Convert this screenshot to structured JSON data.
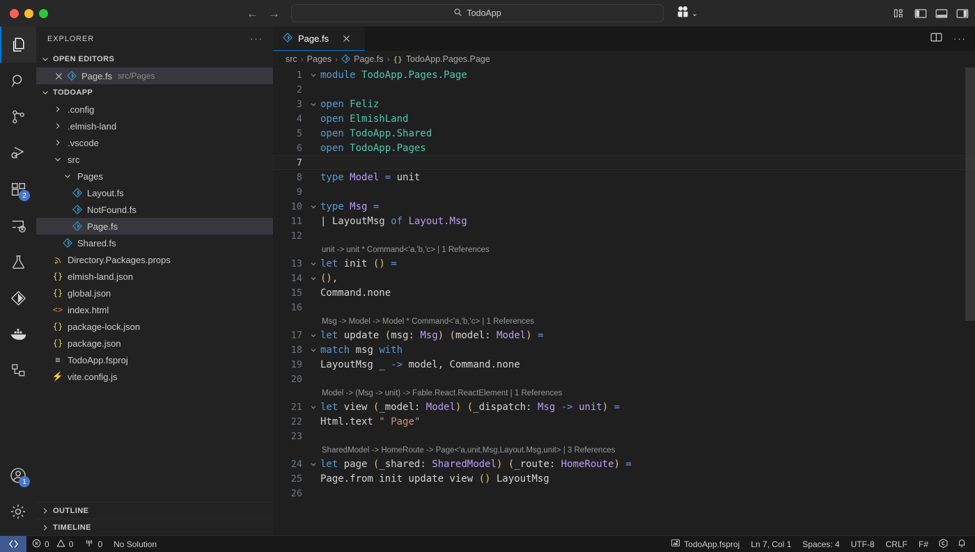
{
  "titlebar": {
    "back_label": "←",
    "forward_label": "→",
    "command_center_text": "TodoApp",
    "search_icon": "search-icon",
    "accounts_icon": "extensions-account-icon",
    "chevron": "⌄",
    "layout_buttons": [
      {
        "name": "customize-layout-button",
        "label": "Customize Layout"
      },
      {
        "name": "toggle-primary-sidebar-button",
        "label": "Toggle Primary Side Bar"
      },
      {
        "name": "toggle-panel-button",
        "label": "Toggle Panel"
      },
      {
        "name": "toggle-secondary-sidebar-button",
        "label": "Toggle Secondary Side Bar"
      }
    ]
  },
  "activitybar": {
    "items": [
      {
        "name": "explorer",
        "label": "Explorer",
        "active": true,
        "badge": ""
      },
      {
        "name": "search",
        "label": "Search",
        "active": false,
        "badge": ""
      },
      {
        "name": "source-control",
        "label": "Source Control",
        "active": false,
        "badge": ""
      },
      {
        "name": "run-and-debug",
        "label": "Run and Debug",
        "active": false,
        "badge": ""
      },
      {
        "name": "extensions",
        "label": "Extensions",
        "active": false,
        "badge": "2"
      },
      {
        "name": "remote-explorer",
        "label": "Remote Explorer",
        "active": false,
        "badge": ""
      },
      {
        "name": "testing",
        "label": "Testing",
        "active": false,
        "badge": ""
      },
      {
        "name": "fsharp",
        "label": "F#",
        "active": false,
        "badge": ""
      },
      {
        "name": "docker",
        "label": "Docker",
        "active": false,
        "badge": ""
      },
      {
        "name": "dev-containers",
        "label": "Dev Containers",
        "active": false,
        "badge": ""
      }
    ],
    "bottom": [
      {
        "name": "accounts",
        "label": "Accounts",
        "badge": "1"
      },
      {
        "name": "manage-settings",
        "label": "Manage",
        "badge": ""
      }
    ]
  },
  "sidebar": {
    "title": "EXPLORER",
    "more_actions": "···",
    "open_editors": {
      "label": "OPEN EDITORS",
      "items": [
        {
          "name": "Page.fs",
          "description": "src/Pages",
          "icon": "fsharp-icon",
          "selected": true
        }
      ]
    },
    "workspace": {
      "label": "TODOAPP",
      "items": [
        {
          "name": ".config",
          "type": "folder",
          "expanded": false,
          "indent": 1,
          "icon": "chevron-right-icon"
        },
        {
          "name": ".elmish-land",
          "type": "folder",
          "expanded": false,
          "indent": 1,
          "icon": "chevron-right-icon"
        },
        {
          "name": ".vscode",
          "type": "folder",
          "expanded": false,
          "indent": 1,
          "icon": "chevron-right-icon"
        },
        {
          "name": "src",
          "type": "folder",
          "expanded": true,
          "indent": 1,
          "icon": "chevron-down-icon"
        },
        {
          "name": "Pages",
          "type": "folder",
          "expanded": true,
          "indent": 2,
          "icon": "chevron-down-icon"
        },
        {
          "name": "Layout.fs",
          "type": "file",
          "indent": 3,
          "icon": "fsharp-icon"
        },
        {
          "name": "NotFound.fs",
          "type": "file",
          "indent": 3,
          "icon": "fsharp-icon"
        },
        {
          "name": "Page.fs",
          "type": "file",
          "indent": 3,
          "icon": "fsharp-icon",
          "selected": true
        },
        {
          "name": "Shared.fs",
          "type": "file",
          "indent": 2,
          "icon": "fsharp-icon"
        },
        {
          "name": "Directory.Packages.props",
          "type": "file",
          "indent": 1,
          "icon": "props-icon"
        },
        {
          "name": "elmish-land.json",
          "type": "file",
          "indent": 1,
          "icon": "json-icon"
        },
        {
          "name": "global.json",
          "type": "file",
          "indent": 1,
          "icon": "json-icon"
        },
        {
          "name": "index.html",
          "type": "file",
          "indent": 1,
          "icon": "html-icon"
        },
        {
          "name": "package-lock.json",
          "type": "file",
          "indent": 1,
          "icon": "json-icon"
        },
        {
          "name": "package.json",
          "type": "file",
          "indent": 1,
          "icon": "json-icon"
        },
        {
          "name": "TodoApp.fsproj",
          "type": "file",
          "indent": 1,
          "icon": "fsproj-icon"
        },
        {
          "name": "vite.config.js",
          "type": "file",
          "indent": 1,
          "icon": "vite-icon"
        }
      ]
    },
    "outline_label": "OUTLINE",
    "timeline_label": "TIMELINE"
  },
  "editor": {
    "tab": {
      "label": "Page.fs",
      "icon": "fsharp-icon",
      "close": "✕"
    },
    "actions": [
      {
        "name": "split-editor-right-button",
        "label": "Split Editor Right"
      },
      {
        "name": "more-editor-actions-button",
        "label": "More Actions..."
      }
    ],
    "breadcrumb": [
      "src",
      "Pages",
      "Page.fs",
      "TodoApp.Pages.Page"
    ],
    "breadcrumb_icons": [
      "",
      "",
      "fsharp-icon",
      "module-icon"
    ],
    "lines": [
      {
        "n": 1,
        "fold": "down",
        "cur": false,
        "tokens": [
          {
            "t": "module",
            "c": "kw"
          },
          {
            "t": " ",
            "c": "pun"
          },
          {
            "t": "TodoApp.Pages.Page",
            "c": "ns"
          }
        ]
      },
      {
        "n": 2,
        "fold": "",
        "cur": false,
        "tokens": []
      },
      {
        "n": 3,
        "fold": "down",
        "cur": false,
        "tokens": [
          {
            "t": "open",
            "c": "kw"
          },
          {
            "t": " ",
            "c": "pun"
          },
          {
            "t": "Feliz",
            "c": "ns"
          }
        ]
      },
      {
        "n": 4,
        "fold": "",
        "cur": false,
        "tokens": [
          {
            "t": "open",
            "c": "kw"
          },
          {
            "t": " ",
            "c": "pun"
          },
          {
            "t": "ElmishLand",
            "c": "ns"
          }
        ]
      },
      {
        "n": 5,
        "fold": "",
        "cur": false,
        "tokens": [
          {
            "t": "open",
            "c": "kw"
          },
          {
            "t": " ",
            "c": "pun"
          },
          {
            "t": "TodoApp.Shared",
            "c": "ns"
          }
        ]
      },
      {
        "n": 6,
        "fold": "",
        "cur": false,
        "tokens": [
          {
            "t": "open",
            "c": "kw"
          },
          {
            "t": " ",
            "c": "pun"
          },
          {
            "t": "TodoApp.Pages",
            "c": "ns"
          }
        ]
      },
      {
        "n": 7,
        "fold": "",
        "cur": true,
        "tokens": []
      },
      {
        "n": 8,
        "fold": "",
        "cur": false,
        "tokens": [
          {
            "t": "type",
            "c": "kw"
          },
          {
            "t": " ",
            "c": "pun"
          },
          {
            "t": "Model",
            "c": "typ"
          },
          {
            "t": " ",
            "c": "pun"
          },
          {
            "t": "=",
            "c": "op"
          },
          {
            "t": " ",
            "c": "pun"
          },
          {
            "t": "unit",
            "c": "id"
          }
        ]
      },
      {
        "n": 9,
        "fold": "",
        "cur": false,
        "tokens": []
      },
      {
        "n": 10,
        "fold": "down",
        "cur": false,
        "tokens": [
          {
            "t": "type",
            "c": "kw"
          },
          {
            "t": " ",
            "c": "pun"
          },
          {
            "t": "Msg",
            "c": "typ"
          },
          {
            "t": " ",
            "c": "pun"
          },
          {
            "t": "=",
            "c": "op"
          }
        ]
      },
      {
        "n": 11,
        "fold": "",
        "cur": false,
        "indentguide": 1,
        "tokens": [
          {
            "t": "    | ",
            "c": "pun"
          },
          {
            "t": "LayoutMsg",
            "c": "id"
          },
          {
            "t": " ",
            "c": "pun"
          },
          {
            "t": "of",
            "c": "kw"
          },
          {
            "t": " ",
            "c": "pun"
          },
          {
            "t": "Layout.Msg",
            "c": "typ"
          }
        ]
      },
      {
        "n": 12,
        "fold": "",
        "cur": false,
        "tokens": []
      },
      {
        "n": 13,
        "fold": "down",
        "cur": false,
        "lens": "unit -> unit * Command<'a,'b,'c> | 1 References",
        "tokens": [
          {
            "t": "let",
            "c": "kw"
          },
          {
            "t": " ",
            "c": "pun"
          },
          {
            "t": "init",
            "c": "id"
          },
          {
            "t": " ",
            "c": "pun"
          },
          {
            "t": "()",
            "c": "yel"
          },
          {
            "t": " ",
            "c": "pun"
          },
          {
            "t": "=",
            "c": "op"
          }
        ]
      },
      {
        "n": 14,
        "fold": "down",
        "cur": false,
        "indentguide": 1,
        "tokens": [
          {
            "t": "    ",
            "c": "pun"
          },
          {
            "t": "()",
            "c": "yel"
          },
          {
            "t": ",",
            "c": "yel"
          }
        ]
      },
      {
        "n": 15,
        "fold": "",
        "cur": false,
        "indentguide": 1,
        "tokens": [
          {
            "t": "    Command.none",
            "c": "id"
          }
        ]
      },
      {
        "n": 16,
        "fold": "",
        "cur": false,
        "tokens": []
      },
      {
        "n": 17,
        "fold": "down",
        "cur": false,
        "lens": "Msg -> Model -> Model * Command<'a,'b,'c> | 1 References",
        "tokens": [
          {
            "t": "let",
            "c": "kw"
          },
          {
            "t": " ",
            "c": "pun"
          },
          {
            "t": "update",
            "c": "id"
          },
          {
            "t": " ",
            "c": "pun"
          },
          {
            "t": "(",
            "c": "yel"
          },
          {
            "t": "msg",
            "c": "id"
          },
          {
            "t": ": ",
            "c": "pun"
          },
          {
            "t": "Msg",
            "c": "typ"
          },
          {
            "t": ")",
            "c": "yel"
          },
          {
            "t": " ",
            "c": "pun"
          },
          {
            "t": "(",
            "c": "yel"
          },
          {
            "t": "model",
            "c": "id"
          },
          {
            "t": ": ",
            "c": "pun"
          },
          {
            "t": "Model",
            "c": "typ"
          },
          {
            "t": ")",
            "c": "yel"
          },
          {
            "t": " ",
            "c": "pun"
          },
          {
            "t": "=",
            "c": "op"
          }
        ]
      },
      {
        "n": 18,
        "fold": "down",
        "cur": false,
        "indentguide": 1,
        "tokens": [
          {
            "t": "    ",
            "c": "pun"
          },
          {
            "t": "match",
            "c": "kw"
          },
          {
            "t": " ",
            "c": "pun"
          },
          {
            "t": "msg",
            "c": "id"
          },
          {
            "t": " ",
            "c": "pun"
          },
          {
            "t": "with",
            "c": "kw"
          }
        ]
      },
      {
        "n": 19,
        "fold": "",
        "cur": false,
        "indentguide": 2,
        "tokens": [
          {
            "t": "    | ",
            "c": "pun"
          },
          {
            "t": "LayoutMsg",
            "c": "id"
          },
          {
            "t": " ",
            "c": "pun"
          },
          {
            "t": "_",
            "c": "id"
          },
          {
            "t": " ",
            "c": "pun"
          },
          {
            "t": "->",
            "c": "op"
          },
          {
            "t": " ",
            "c": "pun"
          },
          {
            "t": "model",
            "c": "id"
          },
          {
            "t": ", ",
            "c": "pun"
          },
          {
            "t": "Command.none",
            "c": "id"
          }
        ]
      },
      {
        "n": 20,
        "fold": "",
        "cur": false,
        "tokens": []
      },
      {
        "n": 21,
        "fold": "down",
        "cur": false,
        "lens": "Model -> (Msg -> unit) -> Fable.React.ReactElement | 1 References",
        "tokens": [
          {
            "t": "let",
            "c": "kw"
          },
          {
            "t": " ",
            "c": "pun"
          },
          {
            "t": "view",
            "c": "id"
          },
          {
            "t": " ",
            "c": "pun"
          },
          {
            "t": "(",
            "c": "yel"
          },
          {
            "t": "_model",
            "c": "id"
          },
          {
            "t": ": ",
            "c": "pun"
          },
          {
            "t": "Model",
            "c": "typ"
          },
          {
            "t": ")",
            "c": "yel"
          },
          {
            "t": " ",
            "c": "pun"
          },
          {
            "t": "(",
            "c": "yel"
          },
          {
            "t": "_dispatch",
            "c": "id"
          },
          {
            "t": ": ",
            "c": "pun"
          },
          {
            "t": "Msg",
            "c": "typ"
          },
          {
            "t": " ",
            "c": "pun"
          },
          {
            "t": "->",
            "c": "op"
          },
          {
            "t": " ",
            "c": "pun"
          },
          {
            "t": "unit",
            "c": "typ"
          },
          {
            "t": ")",
            "c": "yel"
          },
          {
            "t": " ",
            "c": "pun"
          },
          {
            "t": "=",
            "c": "op"
          }
        ]
      },
      {
        "n": 22,
        "fold": "",
        "cur": false,
        "indentguide": 1,
        "tokens": [
          {
            "t": "    Html.text ",
            "c": "id"
          },
          {
            "t": "\" Page\"",
            "c": "str"
          }
        ]
      },
      {
        "n": 23,
        "fold": "",
        "cur": false,
        "tokens": []
      },
      {
        "n": 24,
        "fold": "down",
        "cur": false,
        "lens": "SharedModel -> HomeRoute -> Page<'a,unit,Msg,Layout.Msg,unit> | 3 References",
        "tokens": [
          {
            "t": "let",
            "c": "kw"
          },
          {
            "t": " ",
            "c": "pun"
          },
          {
            "t": "page",
            "c": "id"
          },
          {
            "t": " ",
            "c": "pun"
          },
          {
            "t": "(",
            "c": "yel"
          },
          {
            "t": "_shared",
            "c": "id"
          },
          {
            "t": ": ",
            "c": "pun"
          },
          {
            "t": "SharedModel",
            "c": "typ"
          },
          {
            "t": ")",
            "c": "yel"
          },
          {
            "t": " ",
            "c": "pun"
          },
          {
            "t": "(",
            "c": "yel"
          },
          {
            "t": "_route",
            "c": "id"
          },
          {
            "t": ": ",
            "c": "pun"
          },
          {
            "t": "HomeRoute",
            "c": "typ"
          },
          {
            "t": ")",
            "c": "yel"
          },
          {
            "t": " ",
            "c": "pun"
          },
          {
            "t": "=",
            "c": "op"
          }
        ]
      },
      {
        "n": 25,
        "fold": "",
        "cur": false,
        "indentguide": 1,
        "tokens": [
          {
            "t": "    Page.from init update view ",
            "c": "id"
          },
          {
            "t": "()",
            "c": "yel"
          },
          {
            "t": " ",
            "c": "pun"
          },
          {
            "t": "LayoutMsg",
            "c": "id"
          }
        ]
      },
      {
        "n": 26,
        "fold": "",
        "cur": false,
        "tokens": []
      }
    ]
  },
  "statusbar": {
    "remote_icon": "remote-indicator-icon",
    "errors": "0",
    "warnings": "0",
    "ports": "0",
    "solution": "No Solution",
    "project": "TodoApp.fsproj",
    "cursor": "Ln 7, Col 1",
    "indentation": "Spaces: 4",
    "encoding": "UTF-8",
    "eol": "CRLF",
    "language": "F#",
    "copilot_icon": "copilot-icon",
    "bell_icon": "notifications-bell-icon"
  },
  "colors": {
    "accent": "#0078d4",
    "remote_bg": "#3e5a8e",
    "badge": "#4a78c8",
    "editor_bg": "#1f1f1f",
    "sidebar_bg": "#222222",
    "titlebar_bg": "#282828"
  }
}
